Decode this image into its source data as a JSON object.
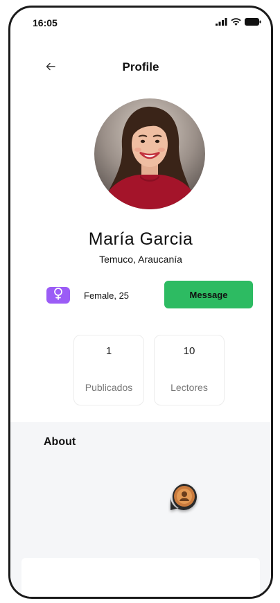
{
  "status_bar": {
    "time": "16:05",
    "icons": [
      "signal-icon",
      "wifi-icon",
      "battery-icon"
    ]
  },
  "header": {
    "title": "Profile",
    "back_icon": "arrow-left-icon"
  },
  "profile": {
    "name": "María  Garcia",
    "location": "Temuco, Araucanía",
    "gender_icon": "female-symbol-icon",
    "gender_age": "Female, 25",
    "message_label": "Message"
  },
  "stats": [
    {
      "value": "1",
      "label": "Publicados"
    },
    {
      "value": "10",
      "label": "Lectores"
    }
  ],
  "about": {
    "title": "About"
  },
  "colors": {
    "accent_green": "#2dbb62",
    "gender_purple": "#9b5cf6",
    "about_bg": "#f5f6f8"
  }
}
